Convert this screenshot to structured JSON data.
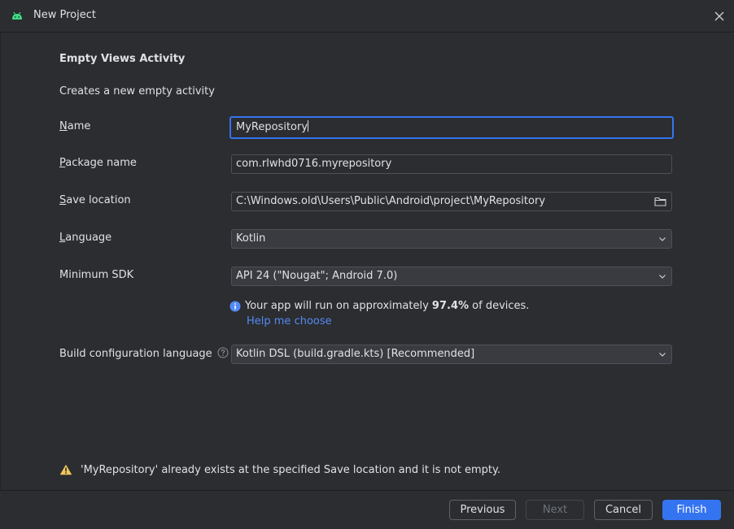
{
  "window": {
    "title": "New Project",
    "icon": "android-icon",
    "close_icon": "close-icon"
  },
  "template": {
    "heading": "Empty Views Activity",
    "description": "Creates a new empty activity"
  },
  "form": {
    "name": {
      "label_first": "N",
      "label_rest": "ame",
      "value": "MyRepository"
    },
    "package_name": {
      "label_first": "P",
      "label_rest": "ackage name",
      "value": "com.rlwhd0716.myrepository"
    },
    "save_location": {
      "label_first": "S",
      "label_rest": "ave location",
      "value": "C:\\Windows.old\\Users\\Public\\Android\\project\\MyRepository",
      "icon": "folder-icon"
    },
    "language": {
      "label_first": "L",
      "label_rest": "anguage",
      "value": "Kotlin"
    },
    "minimum_sdk": {
      "label": "Minimum SDK",
      "value": "API 24 (\"Nougat\"; Android 7.0)"
    },
    "sdk_info": {
      "prefix": "Your app will run on approximately ",
      "percent": "97.4%",
      "suffix": " of devices.",
      "help_link": "Help me choose"
    },
    "build_config": {
      "label": "Build configuration language",
      "value": "Kotlin DSL (build.gradle.kts) [Recommended]"
    }
  },
  "warning": {
    "text": "'MyRepository' already exists at the specified Save location and it is not empty."
  },
  "buttons": {
    "previous": "Previous",
    "next": "Next",
    "cancel": "Cancel",
    "finish": "Finish"
  },
  "colors": {
    "background": "#2b2d30",
    "accent": "#3574f0",
    "link": "#548af7",
    "warning": "#f2c55c",
    "android_green": "#3ddc84"
  }
}
